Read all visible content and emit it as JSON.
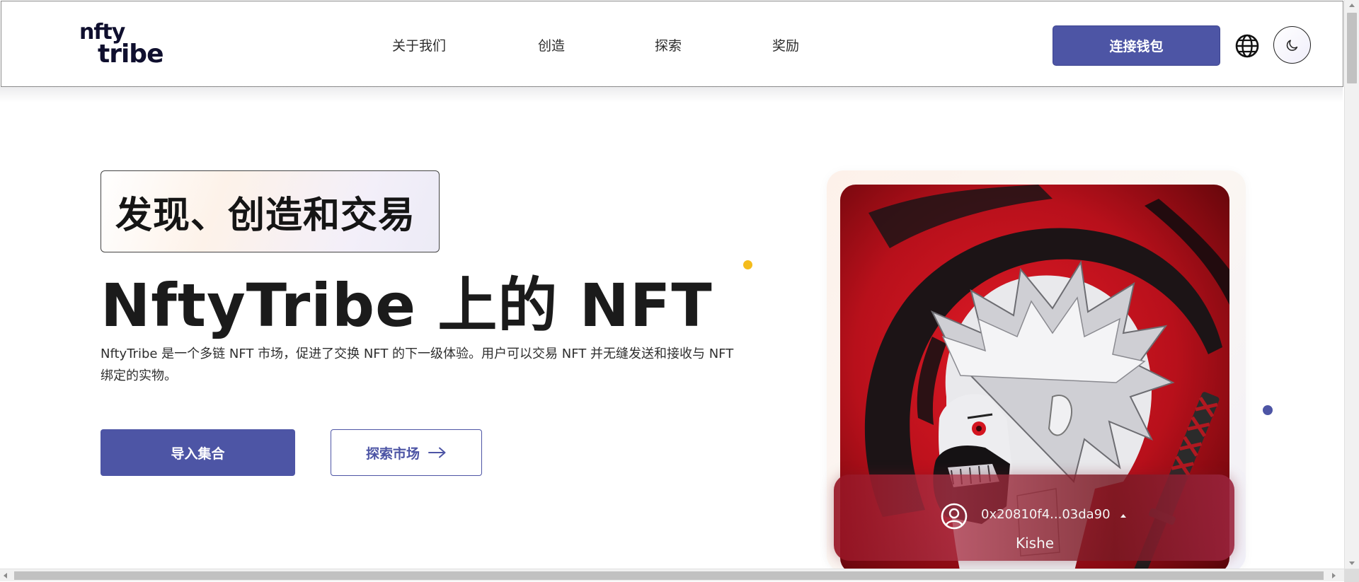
{
  "header": {
    "logo_top": "nfty",
    "logo_bottom": "tribe",
    "nav": [
      {
        "label": "关于我们"
      },
      {
        "label": "创造"
      },
      {
        "label": "探索"
      },
      {
        "label": "奖励"
      }
    ],
    "connect_wallet_label": "连接钱包",
    "icons": {
      "language": "globe-icon",
      "theme": "moon-icon"
    }
  },
  "hero": {
    "tagline": "发现、创造和交易",
    "title": "NftyTribe 上的 NFT",
    "description": "NftyTribe 是一个多链 NFT 市场，促进了交换 NFT 的下一级体验。用户可以交易 NFT 并无缝发送和接收与 NFT 绑定的实物。",
    "import_collection_label": "导入集合",
    "explore_market_label": "探索市场"
  },
  "featured": {
    "owner_address": "0x20810f4...03da90",
    "owner_name": "Kishe"
  },
  "colors": {
    "brand": "#4d55a5",
    "accent_yellow": "#f4bc1c",
    "text": "#1b1b1b"
  }
}
